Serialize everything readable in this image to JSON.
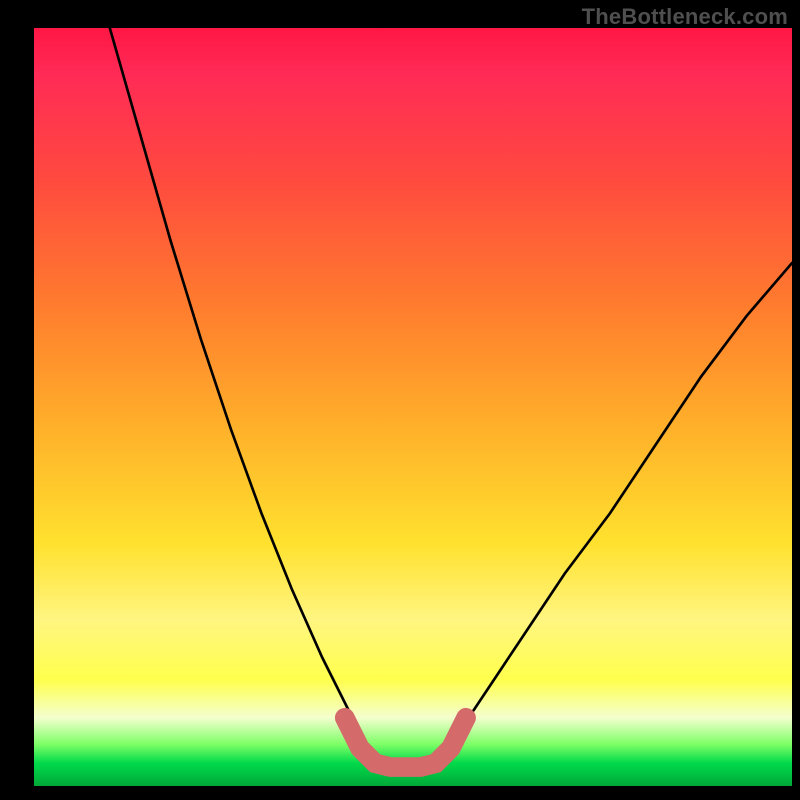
{
  "watermark": "TheBottleneck.com",
  "chart_data": {
    "type": "line",
    "title": "",
    "xlabel": "",
    "ylabel": "",
    "xlim": [
      0,
      100
    ],
    "ylim": [
      0,
      100
    ],
    "grid": false,
    "legend": false,
    "series": [
      {
        "name": "left-branch",
        "stroke": "#000000",
        "x": [
          10,
          14,
          18,
          22,
          26,
          30,
          34,
          38,
          42,
          44
        ],
        "y": [
          100,
          86,
          72,
          59,
          47,
          36,
          26,
          17,
          9,
          5
        ]
      },
      {
        "name": "right-branch",
        "stroke": "#000000",
        "x": [
          54,
          58,
          62,
          66,
          70,
          76,
          82,
          88,
          94,
          100
        ],
        "y": [
          5,
          10,
          16,
          22,
          28,
          36,
          45,
          54,
          62,
          69
        ]
      },
      {
        "name": "trough-highlight",
        "stroke": "#d46a6a",
        "x": [
          41,
          43,
          45,
          47,
          49,
          51,
          53,
          55,
          57
        ],
        "y": [
          9,
          5,
          3,
          2.5,
          2.5,
          2.5,
          3,
          5,
          9
        ]
      }
    ],
    "annotations": []
  }
}
